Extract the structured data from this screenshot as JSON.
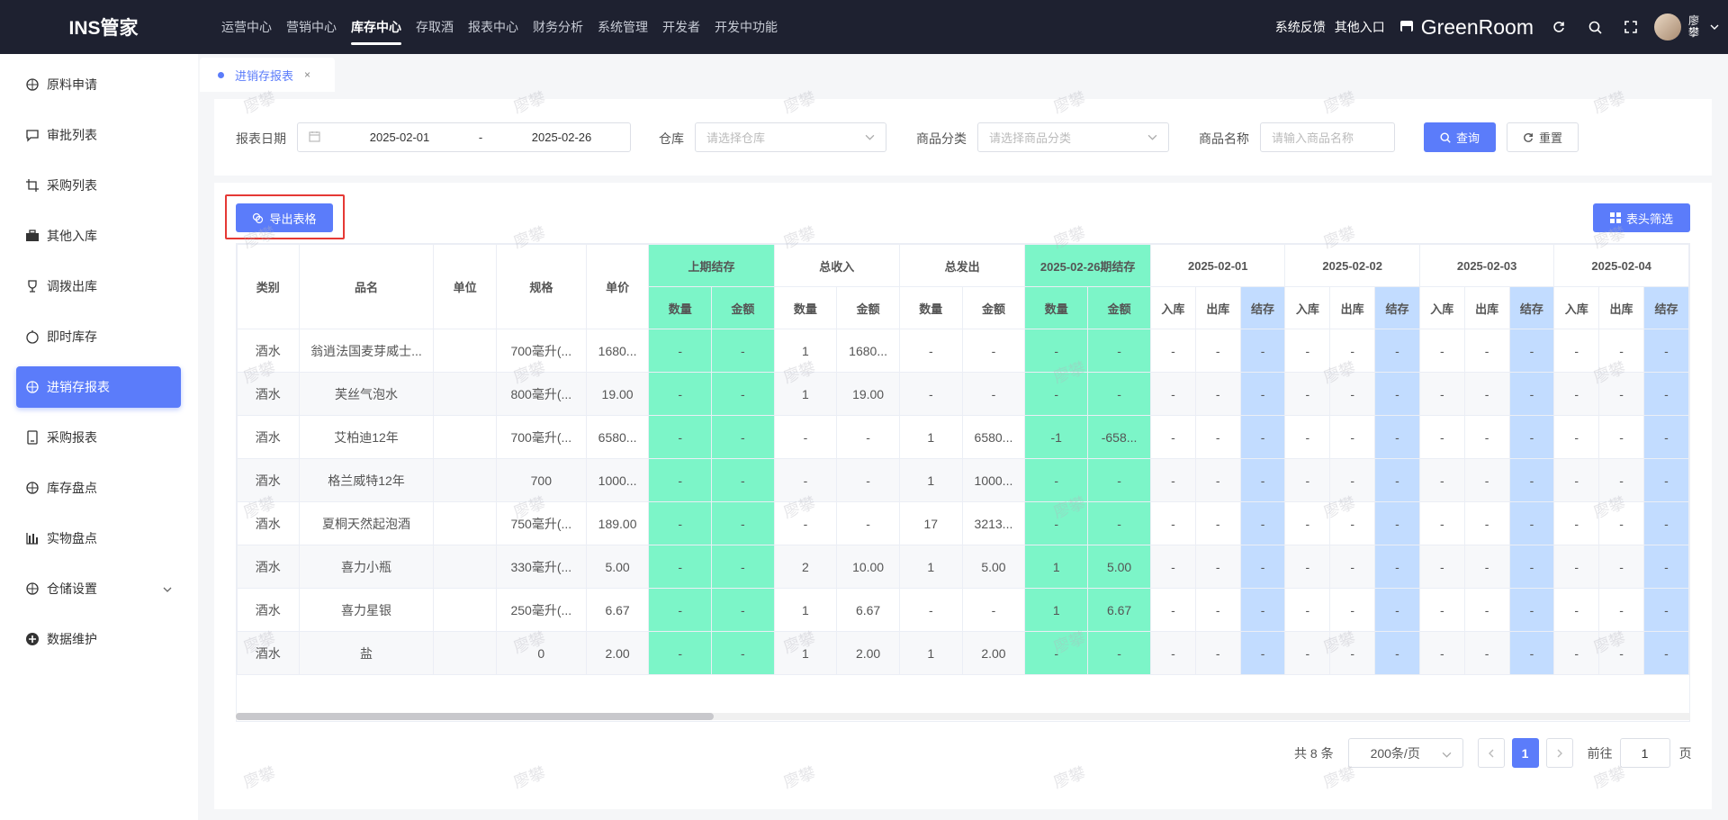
{
  "app": {
    "title": "INS管家"
  },
  "topnav": [
    "运营中心",
    "营销中心",
    "库存中心",
    "存取酒",
    "报表中心",
    "财务分析",
    "系统管理",
    "开发者",
    "开发中功能"
  ],
  "topright": {
    "feedback": "系统反馈",
    "other_entry": "其他入口",
    "store_name": "GreenRoom",
    "user": "廖攀"
  },
  "sidebar": [
    "原料申请",
    "审批列表",
    "采购列表",
    "其他入库",
    "调拨出库",
    "即时库存",
    "进销存报表",
    "采购报表",
    "库存盘点",
    "实物盘点",
    "仓储设置",
    "数据维护"
  ],
  "tab": {
    "label": "进销存报表",
    "close": "×"
  },
  "filters": {
    "date_label": "报表日期",
    "date_start": "2025-02-01",
    "date_sep": "-",
    "date_end": "2025-02-26",
    "warehouse_label": "仓库",
    "warehouse_placeholder": "请选择仓库",
    "category_label": "商品分类",
    "category_placeholder": "请选择商品分类",
    "name_label": "商品名称",
    "name_placeholder": "请输入商品名称",
    "query_button": "查询",
    "reset_button": "重置"
  },
  "toolbar": {
    "export_button": "导出表格",
    "column_filter_button": "表头筛选"
  },
  "table": {
    "fixed_headers": [
      "类别",
      "品名",
      "单位",
      "规格",
      "单价"
    ],
    "group_headers": [
      "上期结存",
      "总收入",
      "总发出",
      "2025-02-26期结存"
    ],
    "qty_label": "数量",
    "amount_label": "金额",
    "date_headers": [
      "2025-02-01",
      "2025-02-02",
      "2025-02-03",
      "2025-02-04"
    ],
    "in_label": "入库",
    "out_label": "出库",
    "stock_label": "结存",
    "rows": [
      {
        "category": "酒水",
        "name": "翁逍法国麦芽威士...",
        "unit": "",
        "spec": "700毫升(...",
        "price": "1680...",
        "vals": [
          "-",
          "-",
          "1",
          "1680...",
          "-",
          "-",
          "-",
          "-"
        ]
      },
      {
        "category": "酒水",
        "name": "芙丝气泡水",
        "unit": "",
        "spec": "800毫升(...",
        "price": "19.00",
        "vals": [
          "-",
          "-",
          "1",
          "19.00",
          "-",
          "-",
          "-",
          "-"
        ]
      },
      {
        "category": "酒水",
        "name": "艾柏迪12年",
        "unit": "",
        "spec": "700毫升(...",
        "price": "6580...",
        "vals": [
          "-",
          "-",
          "-",
          "-",
          "1",
          "6580...",
          "-1",
          "-658..."
        ]
      },
      {
        "category": "酒水",
        "name": "格兰威特12年",
        "unit": "",
        "spec": "700",
        "price": "1000...",
        "vals": [
          "-",
          "-",
          "-",
          "-",
          "1",
          "1000...",
          "-",
          "-"
        ]
      },
      {
        "category": "酒水",
        "name": "夏桐天然起泡酒",
        "unit": "",
        "spec": "750毫升(...",
        "price": "189.00",
        "vals": [
          "-",
          "-",
          "-",
          "-",
          "17",
          "3213...",
          "-",
          "-"
        ]
      },
      {
        "category": "酒水",
        "name": "喜力小瓶",
        "unit": "",
        "spec": "330毫升(...",
        "price": "5.00",
        "vals": [
          "-",
          "-",
          "2",
          "10.00",
          "1",
          "5.00",
          "1",
          "5.00"
        ]
      },
      {
        "category": "酒水",
        "name": "喜力星银",
        "unit": "",
        "spec": "250毫升(...",
        "price": "6.67",
        "vals": [
          "-",
          "-",
          "1",
          "6.67",
          "-",
          "-",
          "1",
          "6.67"
        ]
      },
      {
        "category": "酒水",
        "name": "盐",
        "unit": "",
        "spec": "0",
        "price": "2.00",
        "vals": [
          "-",
          "-",
          "1",
          "2.00",
          "1",
          "2.00",
          "-",
          "-"
        ]
      }
    ],
    "empty_value": "-"
  },
  "pager": {
    "total": "共 8 条",
    "page_size": "200条/页",
    "current_page": "1",
    "goto_label": "前往",
    "goto_value": "1",
    "page_unit": "页"
  },
  "watermark": "廖攀",
  "colors": {
    "primary": "#5b7cfa",
    "green_col": "#7cf5c8",
    "blue_col": "#c2dcff",
    "topbar": "#1e2130",
    "highlight": "#e53935"
  }
}
